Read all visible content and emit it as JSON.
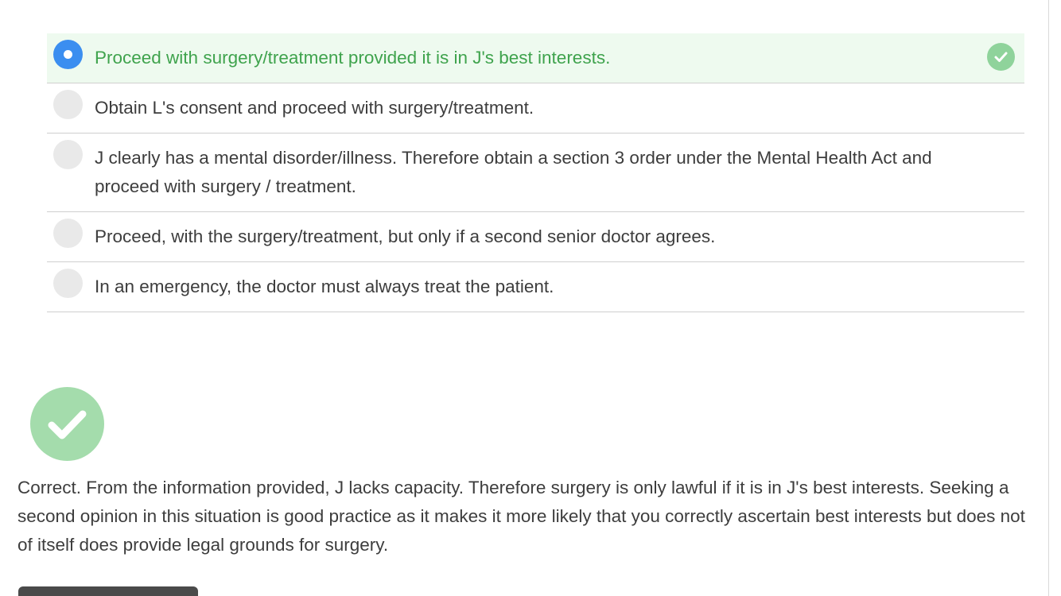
{
  "question": {
    "options": [
      {
        "label": "Proceed with surgery/treatment provided it is in J's best interests.",
        "selected": true,
        "correct": true
      },
      {
        "label": "Obtain L's consent and proceed with surgery/treatment.",
        "selected": false,
        "correct": false
      },
      {
        "label": "J clearly has a mental disorder/illness. Therefore obtain a section 3 order under the Mental Health Act and proceed with surgery / treatment.",
        "selected": false,
        "correct": false
      },
      {
        "label": "Proceed, with the surgery/treatment, but only if a second senior doctor agrees.",
        "selected": false,
        "correct": false
      },
      {
        "label": "In an emergency, the doctor must always treat the patient.",
        "selected": false,
        "correct": false
      }
    ]
  },
  "feedback": {
    "icon": "checkmark-icon",
    "text": "Correct. From the information provided, J lacks capacity. Therefore surgery is only lawful if it is in J's best interests. Seeking a second opinion in this situation is good practice as it makes it more likely that you correctly ascertain best interests but does not of itself does provide legal grounds for surgery."
  },
  "colors": {
    "selected_text": "#3fa34d",
    "selected_background": "#eefaef",
    "radio_selected": "#3b8ef0",
    "correct_badge": "#8fd39b",
    "result_badge": "#a4dcac"
  }
}
